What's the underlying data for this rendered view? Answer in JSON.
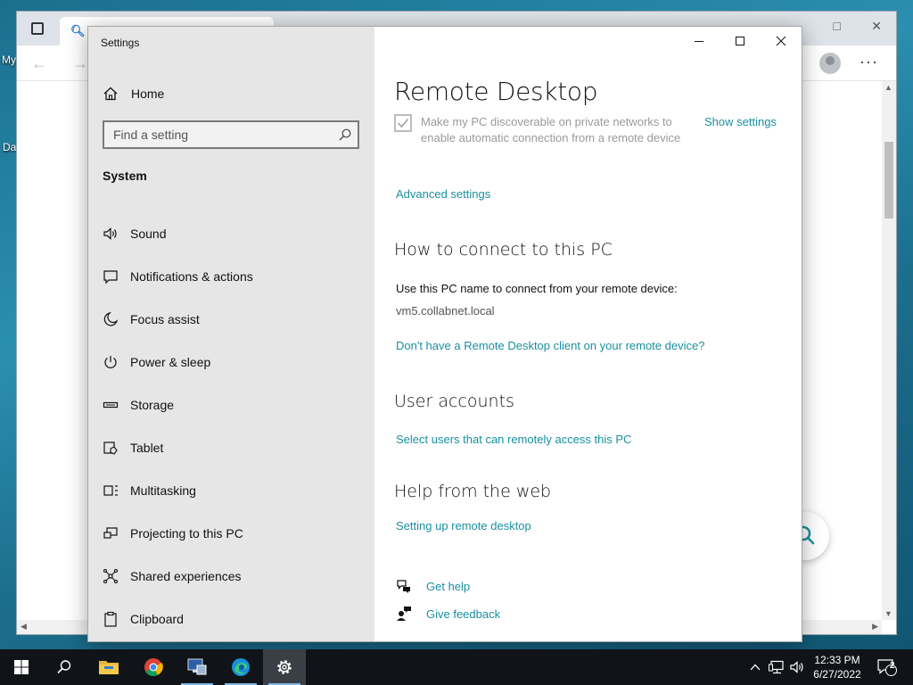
{
  "desktop": {
    "label_1": "My",
    "label_2": "Da"
  },
  "browser": {
    "nav_back": "←",
    "nav_forward": "→",
    "more": "···"
  },
  "settings": {
    "window_title": "Settings",
    "home_label": "Home",
    "search_placeholder": "Find a setting",
    "section_heading": "System",
    "nav_items": [
      {
        "label": "Sound",
        "icon": "speaker-icon"
      },
      {
        "label": "Notifications & actions",
        "icon": "message-icon"
      },
      {
        "label": "Focus assist",
        "icon": "moon-icon"
      },
      {
        "label": "Power & sleep",
        "icon": "power-icon"
      },
      {
        "label": "Storage",
        "icon": "storage-icon"
      },
      {
        "label": "Tablet",
        "icon": "tablet-icon"
      },
      {
        "label": "Multitasking",
        "icon": "multitasking-icon"
      },
      {
        "label": "Projecting to this PC",
        "icon": "projecting-icon"
      },
      {
        "label": "Shared experiences",
        "icon": "shared-icon"
      },
      {
        "label": "Clipboard",
        "icon": "clipboard-icon"
      }
    ],
    "page": {
      "title": "Remote Desktop",
      "discoverable_text": "Make my PC discoverable on private networks to enable automatic connection from a remote device",
      "discoverable_checked": true,
      "show_settings": "Show settings",
      "advanced_settings": "Advanced settings",
      "connect_heading": "How to connect to this PC",
      "connect_text": "Use this PC name to connect from your remote device:",
      "pc_name": "vm5.collabnet.local",
      "no_client_link": "Don't have a Remote Desktop client on your remote device?",
      "accounts_heading": "User accounts",
      "select_users_link": "Select users that can remotely access this PC",
      "help_heading": "Help from the web",
      "setup_link": "Setting up remote desktop",
      "get_help": "Get help",
      "give_feedback": "Give feedback"
    },
    "accent_color": "#1a8fa0"
  },
  "taskbar": {
    "time": "12:33 PM",
    "date": "6/27/2022",
    "notification_count": "2"
  }
}
